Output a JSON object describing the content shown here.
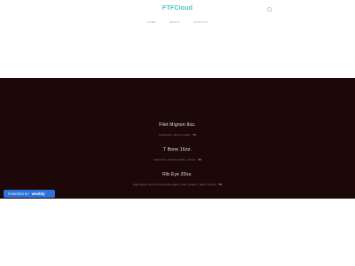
{
  "header": {
    "logo": "FTFCloud",
    "nav": [
      "HOME",
      "ABOUT",
      "CONTACT"
    ]
  },
  "menu": [
    {
      "name": "Filet Mignon 8oz.",
      "description": "tenderloin | chive | butter",
      "price": "35"
    },
    {
      "name": "T Bone 16oz.",
      "description": "thick bone | honey butter | chives",
      "price": "65"
    },
    {
      "name": "Rib Eye 20oz.",
      "description": "argentinian ranch prime black angus | salt | pepper | garlic | butter",
      "price": "65"
    }
  ],
  "badge": {
    "prefix": "POWERED BY",
    "brand": "weebly"
  },
  "colors": {
    "logo": "#4fc3b8",
    "hero_background": "#1c0808",
    "badge": "#2d73d9"
  }
}
